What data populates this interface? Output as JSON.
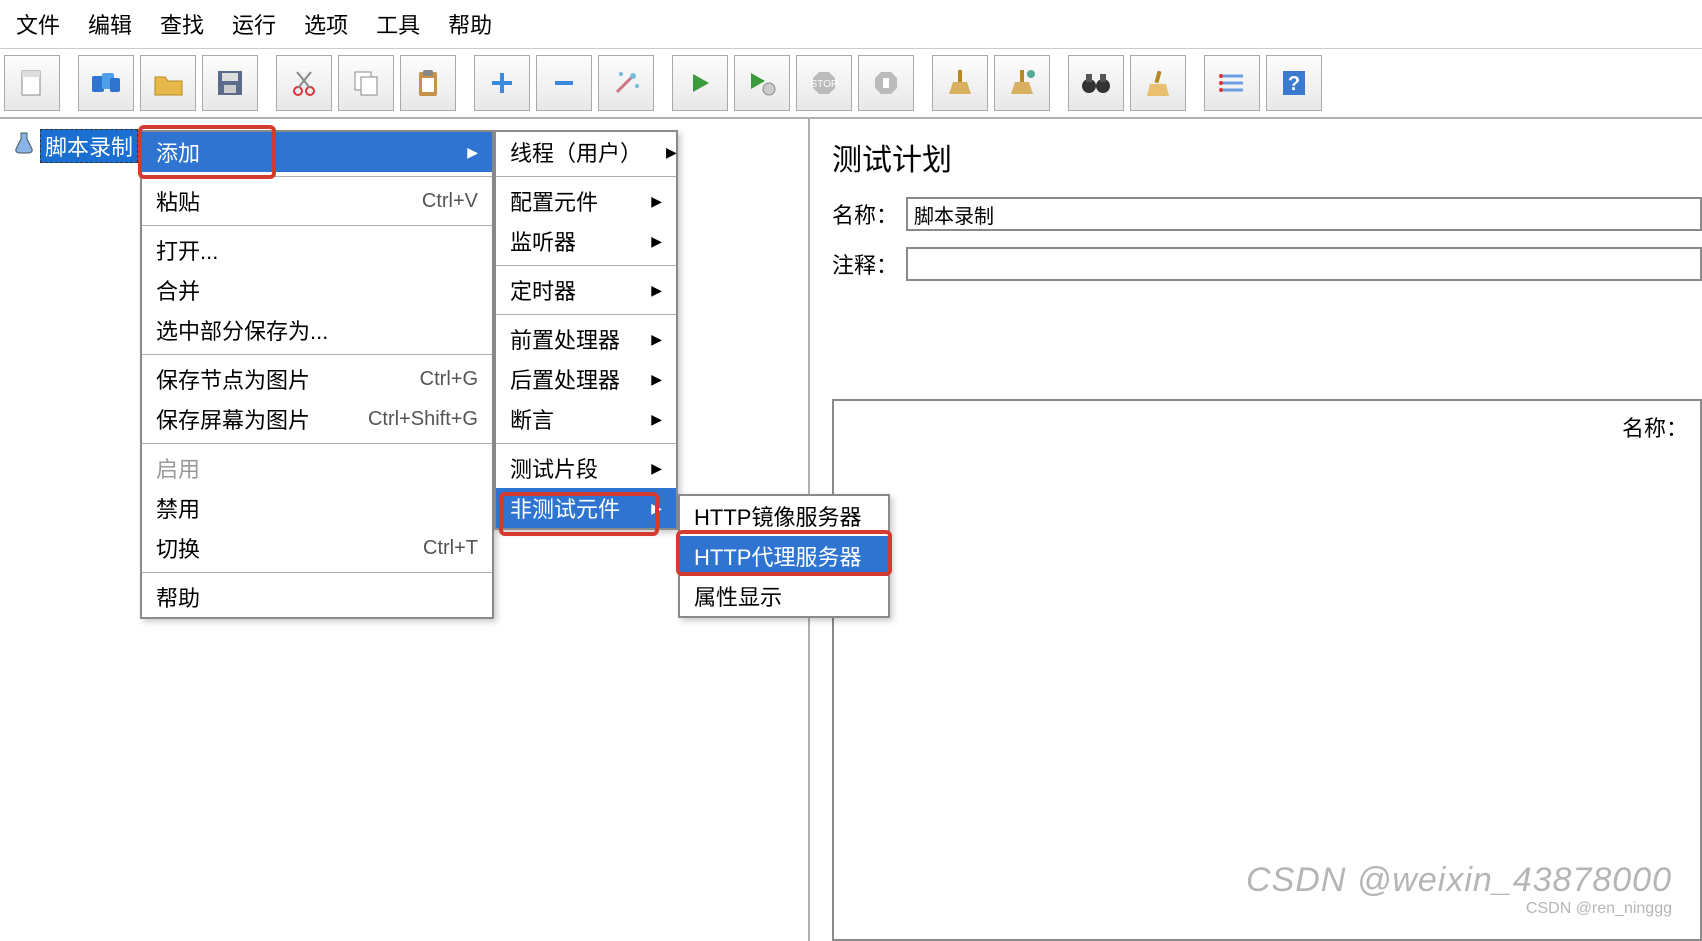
{
  "menubar": [
    "文件",
    "编辑",
    "查找",
    "运行",
    "选项",
    "工具",
    "帮助"
  ],
  "toolbar_icons": [
    "new",
    "open",
    "folder",
    "save",
    "cut",
    "copy",
    "paste",
    "plus",
    "minus",
    "wand",
    "play",
    "play-sub",
    "stop",
    "shutdown",
    "broom1",
    "broom2",
    "binoculars",
    "clean",
    "list",
    "help"
  ],
  "tree": {
    "root_label": "脚本录制"
  },
  "right": {
    "title": "测试计划",
    "name_label": "名称：",
    "name_value": "脚本录制",
    "comment_label": "注释：",
    "comment_value": "",
    "inner_label": "名称："
  },
  "ctx1": [
    {
      "label": "添加",
      "arrow": true,
      "sel": true
    },
    {
      "sep": true
    },
    {
      "label": "粘贴",
      "short": "Ctrl+V"
    },
    {
      "sep": true
    },
    {
      "label": "打开..."
    },
    {
      "label": "合并"
    },
    {
      "label": "选中部分保存为..."
    },
    {
      "sep": true
    },
    {
      "label": "保存节点为图片",
      "short": "Ctrl+G"
    },
    {
      "label": "保存屏幕为图片",
      "short": "Ctrl+Shift+G"
    },
    {
      "sep": true
    },
    {
      "label": "启用",
      "dis": true
    },
    {
      "label": "禁用"
    },
    {
      "label": "切换",
      "short": "Ctrl+T"
    },
    {
      "sep": true
    },
    {
      "label": "帮助"
    }
  ],
  "ctx2": [
    {
      "label": "线程（用户）",
      "arrow": true
    },
    {
      "sep": true
    },
    {
      "label": "配置元件",
      "arrow": true
    },
    {
      "label": "监听器",
      "arrow": true
    },
    {
      "sep": true
    },
    {
      "label": "定时器",
      "arrow": true
    },
    {
      "sep": true
    },
    {
      "label": "前置处理器",
      "arrow": true
    },
    {
      "label": "后置处理器",
      "arrow": true
    },
    {
      "label": "断言",
      "arrow": true
    },
    {
      "sep": true
    },
    {
      "label": "测试片段",
      "arrow": true
    },
    {
      "label": "非测试元件",
      "arrow": true,
      "sel": true
    }
  ],
  "ctx3": [
    {
      "label": "HTTP镜像服务器"
    },
    {
      "label": "HTTP代理服务器",
      "sel": true
    },
    {
      "label": "属性显示"
    }
  ],
  "watermark": "CSDN @weixin_43878000",
  "watermark_small": "CSDN @ren_ninggg"
}
